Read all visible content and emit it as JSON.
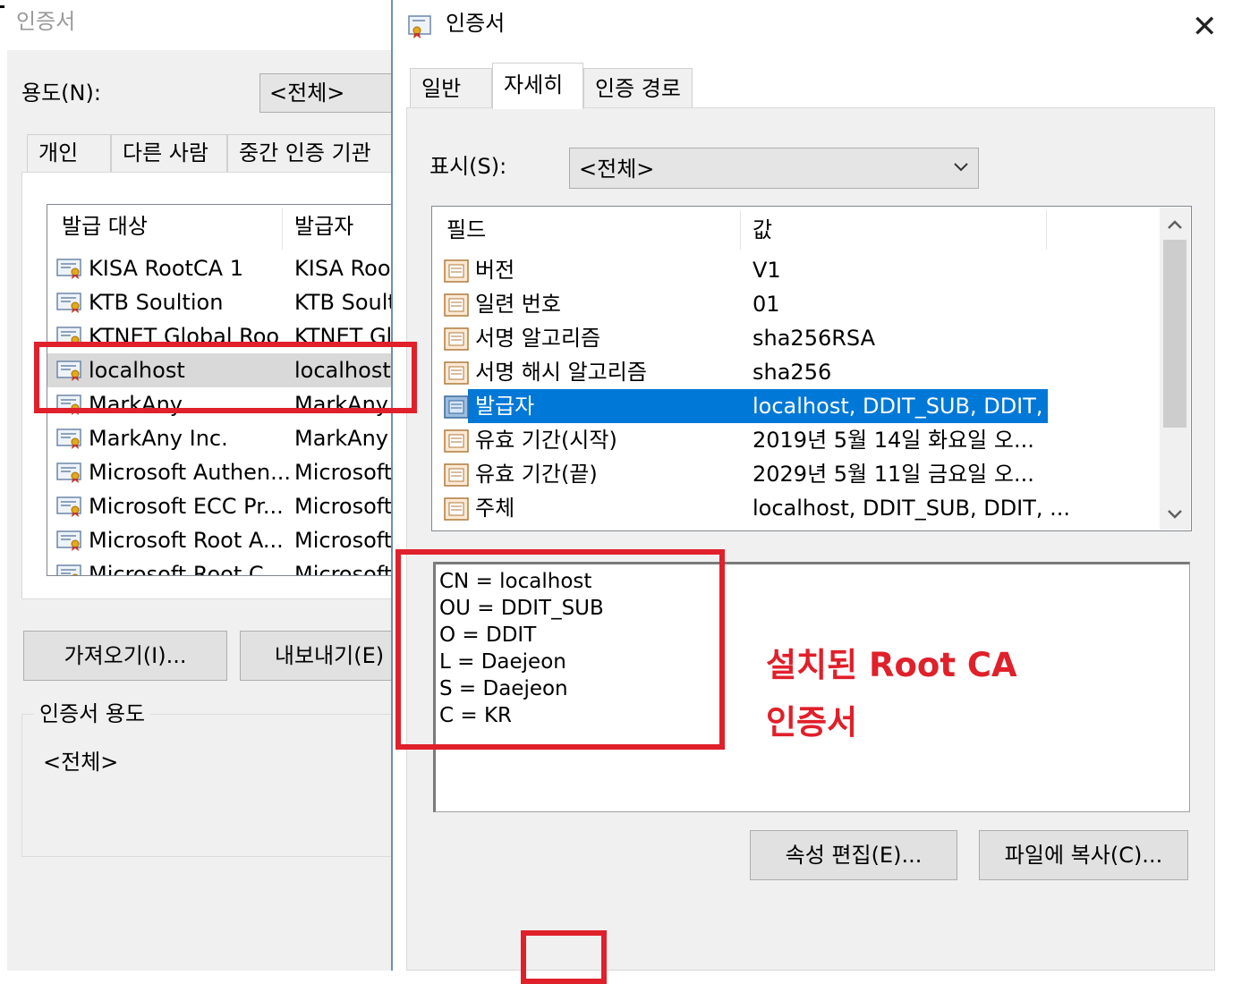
{
  "left_dialog": {
    "title": "인증서",
    "purpose_label": "용도(N):",
    "purpose_value": "<전체>",
    "tabs": [
      "개인",
      "다른 사람",
      "중간 인증 기관"
    ],
    "list_headers": [
      "발급 대상",
      "발급자"
    ],
    "rows": [
      {
        "issued_to": "KISA RootCA 1",
        "issued_by": "KISA Root"
      },
      {
        "issued_to": "KTB Soultion",
        "issued_by": "KTB Soulti"
      },
      {
        "issued_to": "KTNET Global Roo",
        "issued_by": "KTNET Glo"
      },
      {
        "issued_to": "localhost",
        "issued_by": "localhost"
      },
      {
        "issued_to": "MarkAny",
        "issued_by": "MarkAny"
      },
      {
        "issued_to": "MarkAny Inc.",
        "issued_by": "MarkAny I"
      },
      {
        "issued_to": "Microsoft Authen...",
        "issued_by": "Microsoft"
      },
      {
        "issued_to": "Microsoft ECC Pr...",
        "issued_by": "Microsoft"
      },
      {
        "issued_to": "Microsoft Root A...",
        "issued_by": "Microsoft"
      },
      {
        "issued_to": "Microsoft Root C...",
        "issued_by": "Microsoft"
      }
    ],
    "selected_row": "localhost",
    "import_button": "가져오기(I)...",
    "export_button": "내보내기(E)",
    "usage_group_title": "인증서 용도",
    "usage_value": "<전체>"
  },
  "right_dialog": {
    "title": "인증서",
    "close_glyph": "✕",
    "tabs": [
      "일반",
      "자세히",
      "인증 경로"
    ],
    "active_tab": "자세히",
    "show_label": "표시(S):",
    "show_value": "<전체>",
    "field_headers": [
      "필드",
      "값"
    ],
    "fields": [
      {
        "field": "버전",
        "value": "V1"
      },
      {
        "field": "일련 번호",
        "value": "01"
      },
      {
        "field": "서명 알고리즘",
        "value": "sha256RSA"
      },
      {
        "field": "서명 해시 알고리즘",
        "value": "sha256"
      },
      {
        "field": "발급자",
        "value": "localhost, DDIT_SUB, DDIT, ..."
      },
      {
        "field": "유효 기간(시작)",
        "value": "2019년 5월 14일 화요일 오..."
      },
      {
        "field": "유효 기간(끝)",
        "value": "2029년 5월 11일 금요일 오..."
      },
      {
        "field": "주체",
        "value": "localhost, DDIT_SUB, DDIT, ..."
      }
    ],
    "selected_field": "발급자",
    "detail_lines": [
      "CN = localhost",
      "OU = DDIT_SUB",
      "O = DDIT",
      "L = Daejeon",
      "S = Daejeon",
      "C = KR"
    ],
    "edit_properties_button": "속성 편집(E)...",
    "copy_to_file_button": "파일에 복사(C)..."
  },
  "annotation": {
    "line1": "설치된 Root CA",
    "line2": "인증서",
    "color": "#e0202a"
  },
  "colors": {
    "selection_blue": "#0078d7",
    "dialog_gray": "#f0f0f0",
    "button_gray": "#e1e1e1"
  },
  "icons": {
    "certificate": "certificate-icon",
    "field": "field-doc-icon",
    "chevron": "chevron-down-icon",
    "close": "close-icon"
  }
}
